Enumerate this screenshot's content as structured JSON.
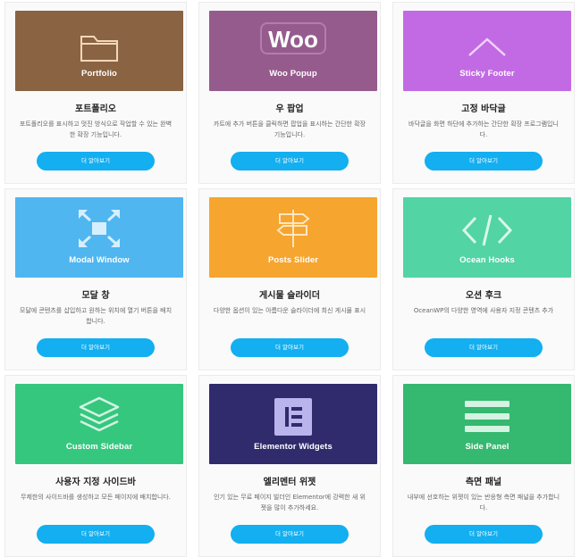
{
  "cards": [
    {
      "banner_label": "Portfolio",
      "color": "#8a6342",
      "icon": "folder-icon",
      "title": "포트폴리오",
      "desc": "포트폴리오를 표시하고 멋진 방식으로 작업할 수 있는 완벽한 확장 기능입니다.",
      "button": "더 알아보기"
    },
    {
      "banner_label": "Woo Popup",
      "color": "#965b8d",
      "icon": "woo-logo-icon",
      "title": "우 팝업",
      "desc": "카트에 추가 버튼을 클릭하면 팝업을 표시하는 간단한 확장 기능입니다.",
      "button": "더 알아보기"
    },
    {
      "banner_label": "Sticky Footer",
      "color": "#c26ae4",
      "icon": "chevron-up-icon",
      "title": "고정 바닥글",
      "desc": "바닥글을 화면 하단에 추가하는 간단한 확장 프로그램입니다.",
      "button": "더 알아보기"
    },
    {
      "banner_label": "Modal Window",
      "color": "#4fb6f0",
      "icon": "expand-arrows-icon",
      "title": "모달 창",
      "desc": "모달에 콘텐츠를 삽입하고 원하는 위치에 열기 버튼을 배치합니다.",
      "button": "더 알아보기"
    },
    {
      "banner_label": "Posts Slider",
      "color": "#f6a52f",
      "icon": "signpost-icon",
      "title": "게시물 슬라이더",
      "desc": "다양한 옵션이 있는 아름다운 슬라이더에 최신 게시물 표시",
      "button": "더 알아보기"
    },
    {
      "banner_label": "Ocean Hooks",
      "color": "#52d4a5",
      "icon": "code-icon",
      "title": "오션 후크",
      "desc": "OceanWP의 다양한 영역에 사용자 지정 콘텐츠 추가",
      "button": "더 알아보기"
    },
    {
      "banner_label": "Custom Sidebar",
      "color": "#36c77f",
      "icon": "layers-icon",
      "title": "사용자 지정 사이드바",
      "desc": "무제한의 사이드바를 생성하고 모든 페이지에 배치합니다.",
      "button": "더 알아보기"
    },
    {
      "banner_label": "Elementor Widgets",
      "color": "#2f2b6c",
      "icon": "elementor-logo-icon",
      "title": "엘리멘터 위젯",
      "desc": "인기 있는 무료 페이지 빌더인 Elementor에 강력한 새 위젯을 많이 추가하세요.",
      "button": "더 알아보기"
    },
    {
      "banner_label": "Side Panel",
      "color": "#35b86f",
      "icon": "menu-lines-icon",
      "title": "측면 패널",
      "desc": "내부에 선호하는 위젯이 있는 반응형 측면 패널을 추가합니다.",
      "button": "더 알아보기"
    }
  ]
}
